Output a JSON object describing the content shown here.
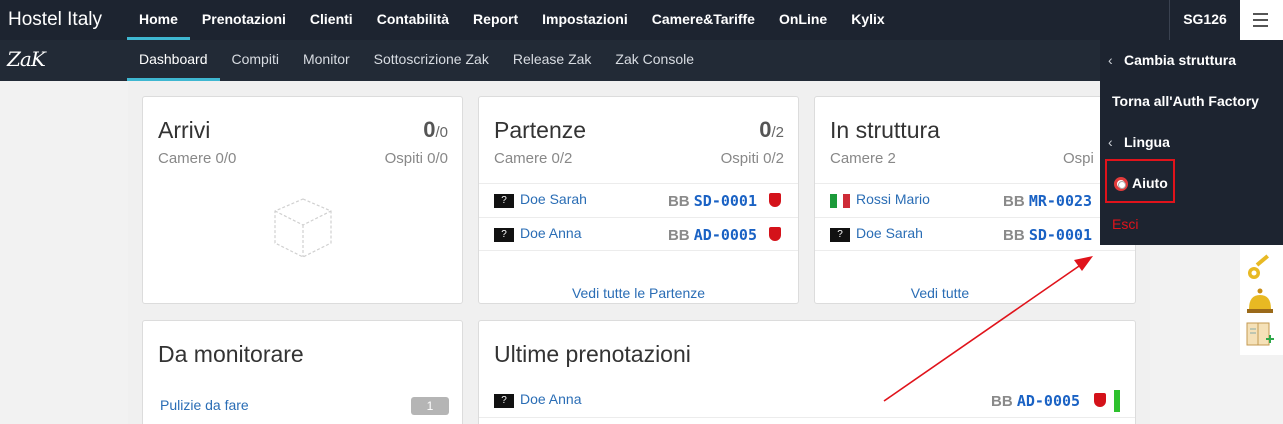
{
  "app": {
    "title": "Hostel Italy",
    "logo": "ZaK",
    "user": "SG126"
  },
  "topnav": [
    "Home",
    "Prenotazioni",
    "Clienti",
    "Contabilità",
    "Report",
    "Impostazioni",
    "Camere&Tariffe",
    "OnLine",
    "Kylix"
  ],
  "subnav": [
    "Dashboard",
    "Compiti",
    "Monitor",
    "Sottoscrizione Zak",
    "Release Zak",
    "Zak Console"
  ],
  "arrivi": {
    "title": "Arrivi",
    "count": "0",
    "total": "/0",
    "rooms": "Camere 0/0",
    "guests": "Ospiti 0/0"
  },
  "partenze": {
    "title": "Partenze",
    "count": "0",
    "total": "/2",
    "rooms": "Camere 0/2",
    "guests": "Ospiti 0/2",
    "rows": [
      {
        "flag": "?",
        "name": "Doe Sarah",
        "bb": "BB",
        "ref": "SD-0001"
      },
      {
        "flag": "?",
        "name": "Doe Anna",
        "bb": "BB",
        "ref": "AD-0005"
      }
    ],
    "link": "Vedi tutte le Partenze"
  },
  "in_struttura": {
    "title": "In struttura",
    "rooms": "Camere 2",
    "guests": "Ospi",
    "rows": [
      {
        "flag": "italy",
        "name": "Rossi Mario",
        "bb": "BB",
        "ref": "MR-0023"
      },
      {
        "flag": "?",
        "name": "Doe Sarah",
        "bb": "BB",
        "ref": "SD-0001"
      }
    ],
    "link": "Vedi tutte"
  },
  "monitor": {
    "title": "Da monitorare",
    "item": "Pulizie da fare",
    "badge": "1"
  },
  "ultime": {
    "title": "Ultime prenotazioni",
    "rows": [
      {
        "flag": "?",
        "name": "Doe Anna",
        "bb": "BB",
        "ref": "AD-0005"
      }
    ]
  },
  "dropdown": {
    "items": [
      "Cambia struttura",
      "Torna all'Auth Factory",
      "Lingua",
      "Aiuto",
      "Esci"
    ],
    "esci_color": "#e0131b"
  },
  "colors": {
    "accent": "#3fb7d1",
    "link": "#2a6db5",
    "topbar": "#1d2430",
    "subbar": "#222a36"
  },
  "sidebar_icons": [
    "key-icon",
    "bell-icon",
    "book-add-icon"
  ]
}
